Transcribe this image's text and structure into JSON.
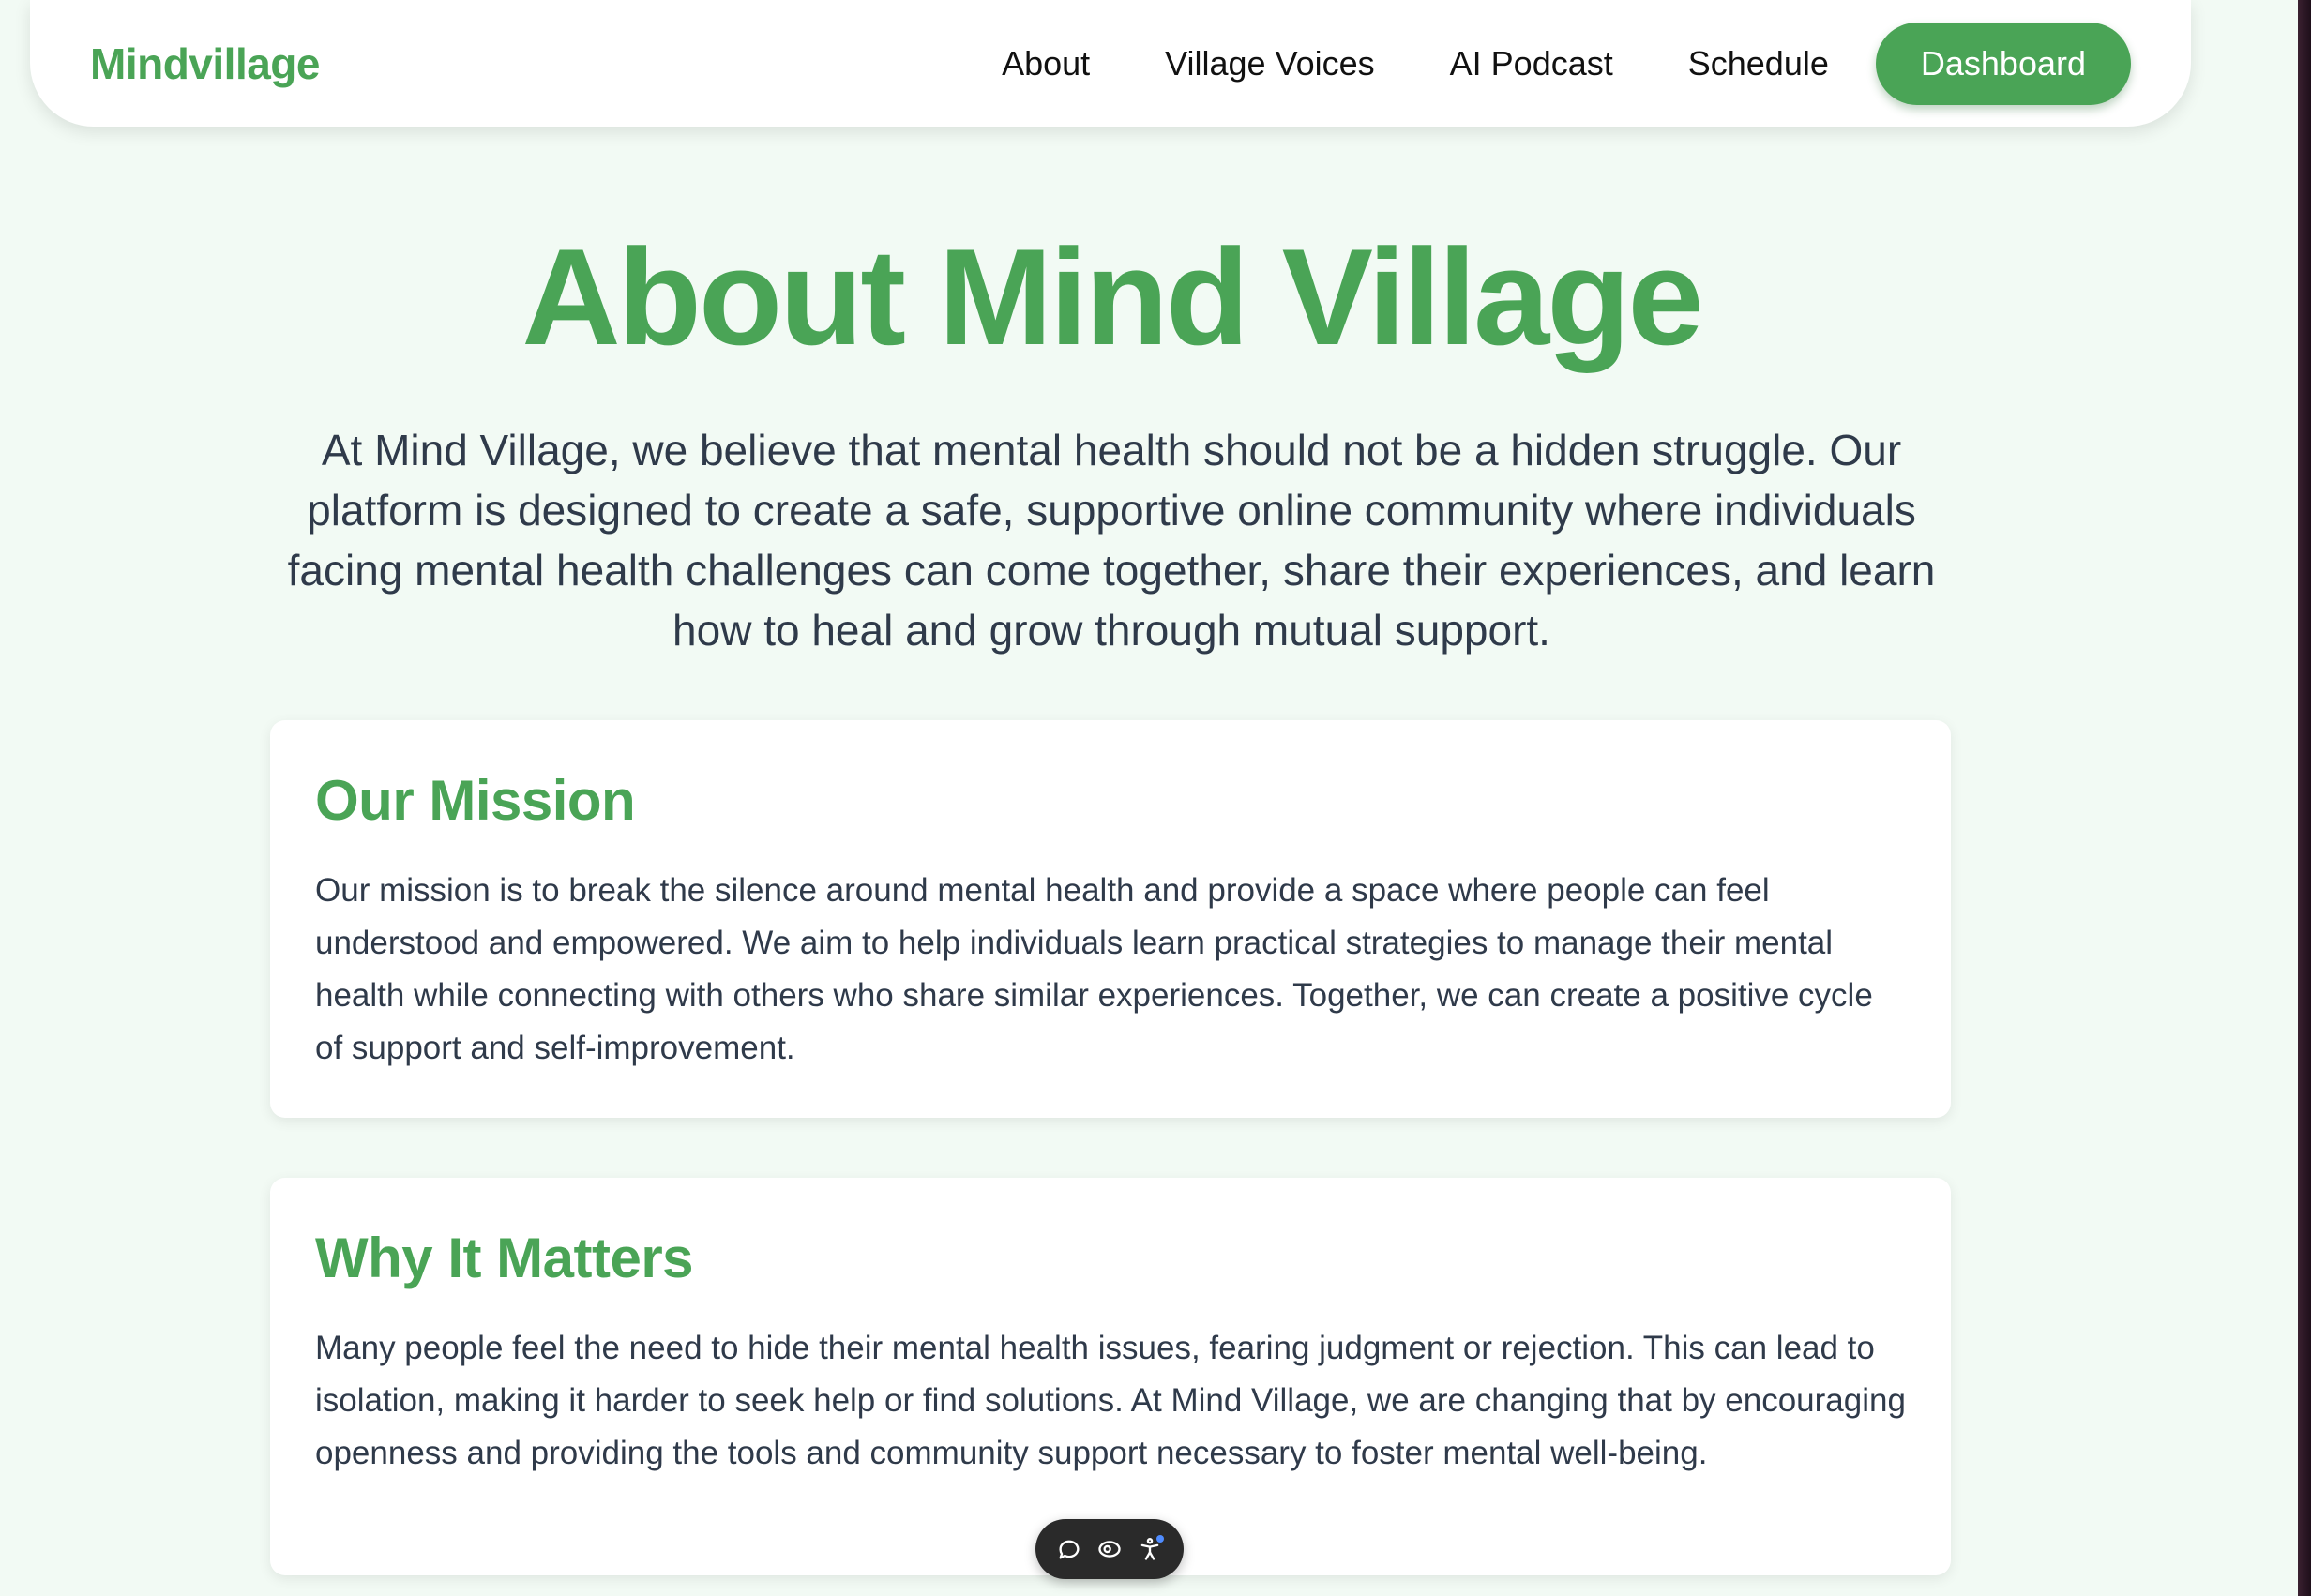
{
  "nav": {
    "brand": "Mindvillage",
    "links": [
      "About",
      "Village Voices",
      "AI Podcast",
      "Schedule"
    ],
    "cta_label": "Dashboard"
  },
  "hero": {
    "title": "About Mind Village",
    "intro": "At Mind Village, we believe that mental health should not be a hidden struggle. Our platform is designed to create a safe, supportive online community where individuals facing mental health challenges can come together, share their experiences, and learn how to heal and grow through mutual support."
  },
  "sections": [
    {
      "title": "Our Mission",
      "body": "Our mission is to break the silence around mental health and provide a space where people can feel understood and empowered. We aim to help individuals learn practical strategies to manage their mental health while connecting with others who share similar experiences. Together, we can create a positive cycle of support and self-improvement."
    },
    {
      "title": "Why It Matters",
      "body": "Many people feel the need to hide their mental health issues, fearing judgment or rejection. This can lead to isolation, making it harder to seek help or find solutions. At Mind Village, we are changing that by encouraging openness and providing the tools and community support necessary to foster mental well-being."
    }
  ],
  "toolbar": {
    "icons": [
      "comment-icon",
      "eye-icon",
      "accessibility-icon"
    ]
  },
  "colors": {
    "accent": "#4aa456",
    "page_bg": "#f2faf4",
    "text": "#2f3a4a",
    "card_bg": "#ffffff",
    "toolbar_bg": "#2a2a2a"
  }
}
